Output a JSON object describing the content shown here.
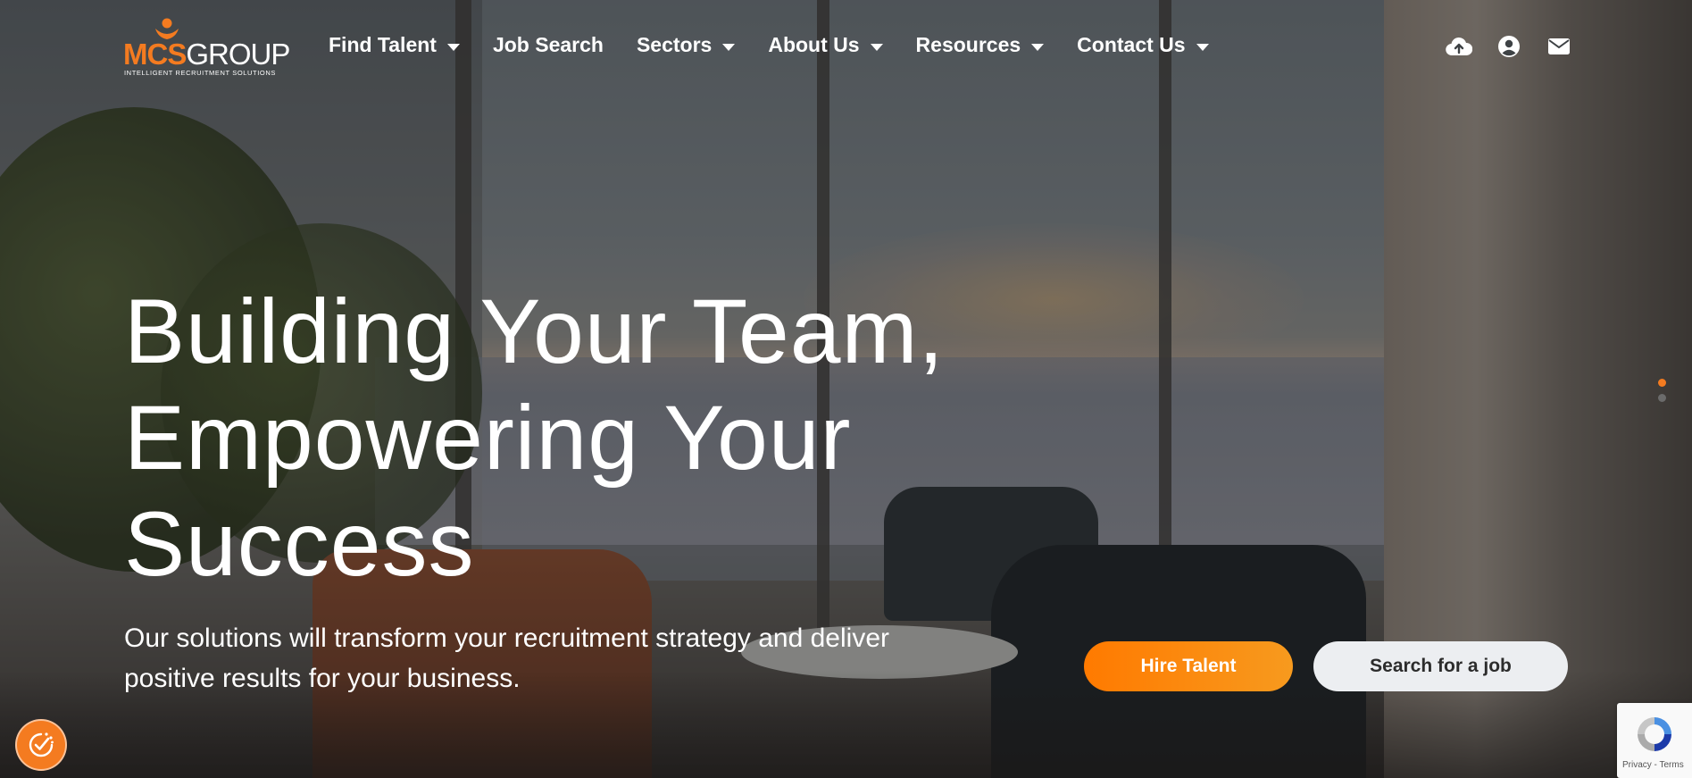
{
  "brand": {
    "logo_mcs": "MCS",
    "logo_group": "GROUP",
    "tagline": "INTELLIGENT RECRUITMENT SOLUTIONS",
    "accent_color": "#f47b20"
  },
  "nav": {
    "items": [
      {
        "label": "Find Talent",
        "has_dropdown": true
      },
      {
        "label": "Job Search",
        "has_dropdown": false
      },
      {
        "label": "Sectors",
        "has_dropdown": true
      },
      {
        "label": "About Us",
        "has_dropdown": true
      },
      {
        "label": "Resources",
        "has_dropdown": true
      },
      {
        "label": "Contact Us",
        "has_dropdown": true
      }
    ]
  },
  "header_icons": [
    "cloud-upload-icon",
    "user-circle-icon",
    "envelope-icon"
  ],
  "hero": {
    "headline_lines": [
      "Building Your Team,",
      "Empowering Your",
      "Success"
    ],
    "subtext_lines": [
      "Our solutions will transform your recruitment strategy and deliver",
      "positive results for your business."
    ],
    "cta_primary": "Hire Talent",
    "cta_secondary": "Search for a job"
  },
  "slider": {
    "active_index": 0,
    "total": 2,
    "active_color": "#f47b20",
    "inactive_color": "#6b6b6b"
  },
  "cookie_badge": {
    "icon": "cookie-consent-icon"
  },
  "recaptcha": {
    "links": "Privacy - Terms"
  }
}
